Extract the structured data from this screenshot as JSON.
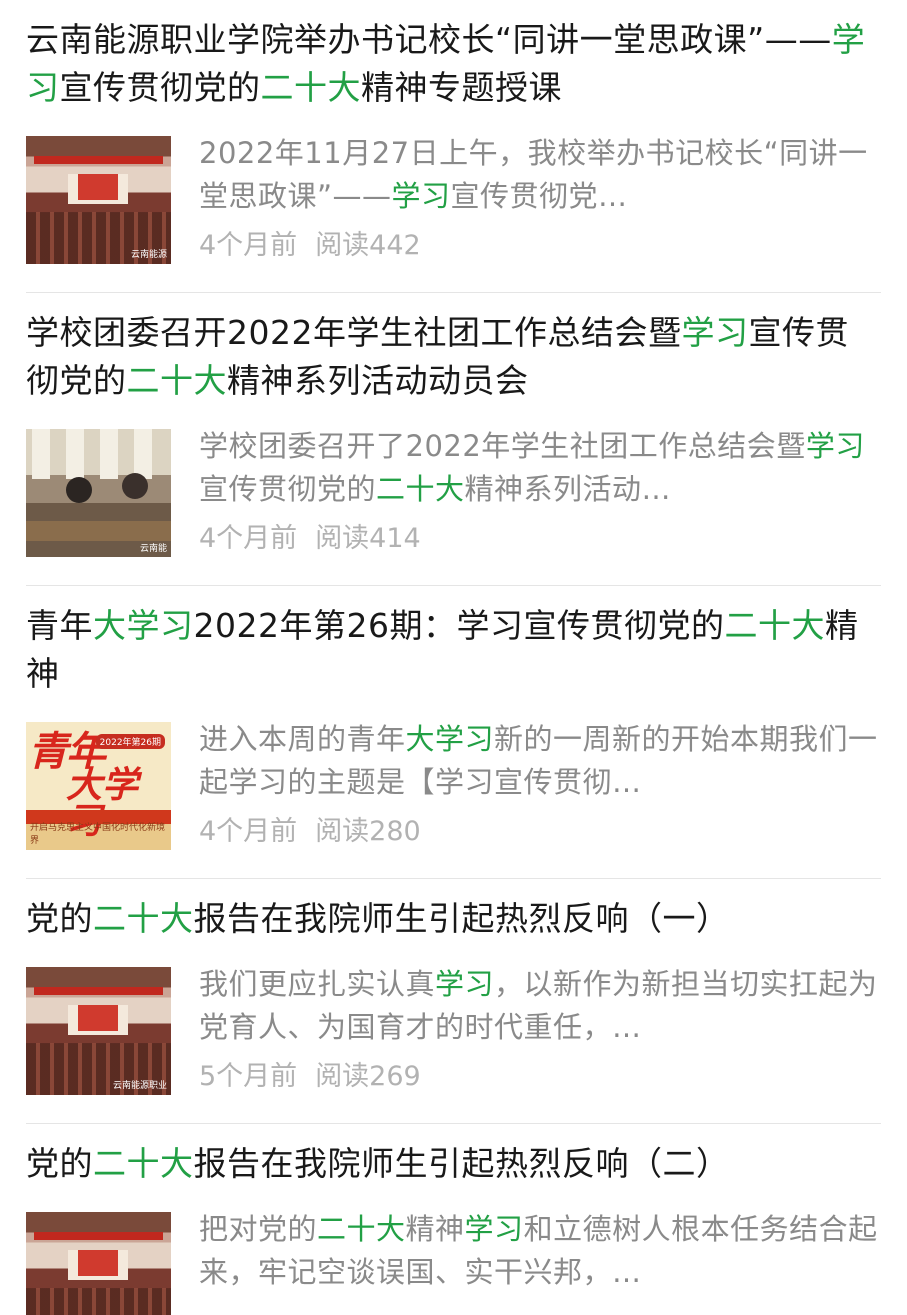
{
  "articles": [
    {
      "title_parts": [
        {
          "text": "云南能源职业学院举办书记校长“同讲一堂思政课”——",
          "hl": false
        },
        {
          "text": "学习",
          "hl": true
        },
        {
          "text": "宣传贯彻党的",
          "hl": false
        },
        {
          "text": "二十大",
          "hl": true
        },
        {
          "text": "精神专题授课",
          "hl": false
        }
      ],
      "summary_parts": [
        {
          "text": "2022年11月27日上午，我校举办书记校长“同讲一堂思政课”——",
          "hl": false
        },
        {
          "text": "学习",
          "hl": true
        },
        {
          "text": "宣传贯彻党…",
          "hl": false
        }
      ],
      "time": "4个月前",
      "reads": "阅读442",
      "thumb": "hall-icon"
    },
    {
      "title_parts": [
        {
          "text": "学校团委召开2022年学生社团工作总结会暨",
          "hl": false
        },
        {
          "text": "学习",
          "hl": true
        },
        {
          "text": "宣传贯彻党的",
          "hl": false
        },
        {
          "text": "二十大",
          "hl": true
        },
        {
          "text": "精神系列活动动员会",
          "hl": false
        }
      ],
      "summary_parts": [
        {
          "text": "学校团委召开了2022年学生社团工作总结会暨",
          "hl": false
        },
        {
          "text": "学习",
          "hl": true
        },
        {
          "text": "宣传贯彻党的",
          "hl": false
        },
        {
          "text": "二十大",
          "hl": true
        },
        {
          "text": "精神系列活动…",
          "hl": false
        }
      ],
      "time": "4个月前",
      "reads": "阅读414",
      "thumb": "meeting-icon"
    },
    {
      "title_parts": [
        {
          "text": "青年",
          "hl": false
        },
        {
          "text": "大学习",
          "hl": true
        },
        {
          "text": "2022年第26期：学习宣传贯彻党的",
          "hl": false
        },
        {
          "text": "二十大",
          "hl": true
        },
        {
          "text": "精神",
          "hl": false
        }
      ],
      "summary_parts": [
        {
          "text": "进入本周的青年",
          "hl": false
        },
        {
          "text": "大学习",
          "hl": true
        },
        {
          "text": "新的一周新的开始本期我们一起学习的主题是【学习宣传贯彻…",
          "hl": false
        }
      ],
      "time": "4个月前",
      "reads": "阅读280",
      "thumb": "youth-study-icon"
    },
    {
      "title_parts": [
        {
          "text": "党的",
          "hl": false
        },
        {
          "text": "二十大",
          "hl": true
        },
        {
          "text": "报告在我院师生引起热烈反响（一）",
          "hl": false
        }
      ],
      "summary_parts": [
        {
          "text": "我们更应扎实认真",
          "hl": false
        },
        {
          "text": "学习",
          "hl": true
        },
        {
          "text": "，以新作为新担当切实扛起为党育人、为国育才的时代重任，…",
          "hl": false
        }
      ],
      "time": "5个月前",
      "reads": "阅读269",
      "thumb": "hall-icon"
    },
    {
      "title_parts": [
        {
          "text": "党的",
          "hl": false
        },
        {
          "text": "二十大",
          "hl": true
        },
        {
          "text": "报告在我院师生引起热烈反响（二）",
          "hl": false
        }
      ],
      "summary_parts": [
        {
          "text": "把对党的",
          "hl": false
        },
        {
          "text": "二十大",
          "hl": true
        },
        {
          "text": "精神",
          "hl": false
        },
        {
          "text": "学习",
          "hl": true
        },
        {
          "text": "和立德树人根本任务结合起来，牢记空谈误国、实干兴邦，…",
          "hl": false
        }
      ],
      "time": "",
      "reads": "",
      "thumb": "hall-icon"
    }
  ],
  "thumb_text": {
    "watermark_1": "云南能源",
    "watermark_2": "云南能",
    "watermark_4": "云南能源职业",
    "youth_big_1": "青年",
    "youth_big_2": "大学习",
    "youth_tag": "2022年第26期",
    "youth_foot": "开启马克思主义中国化时代化新境界"
  },
  "colors": {
    "highlight": "#22a045",
    "title": "#191919",
    "summary": "#8a8a8a",
    "meta": "#b2b2b2",
    "divider": "#e5e5e5"
  }
}
